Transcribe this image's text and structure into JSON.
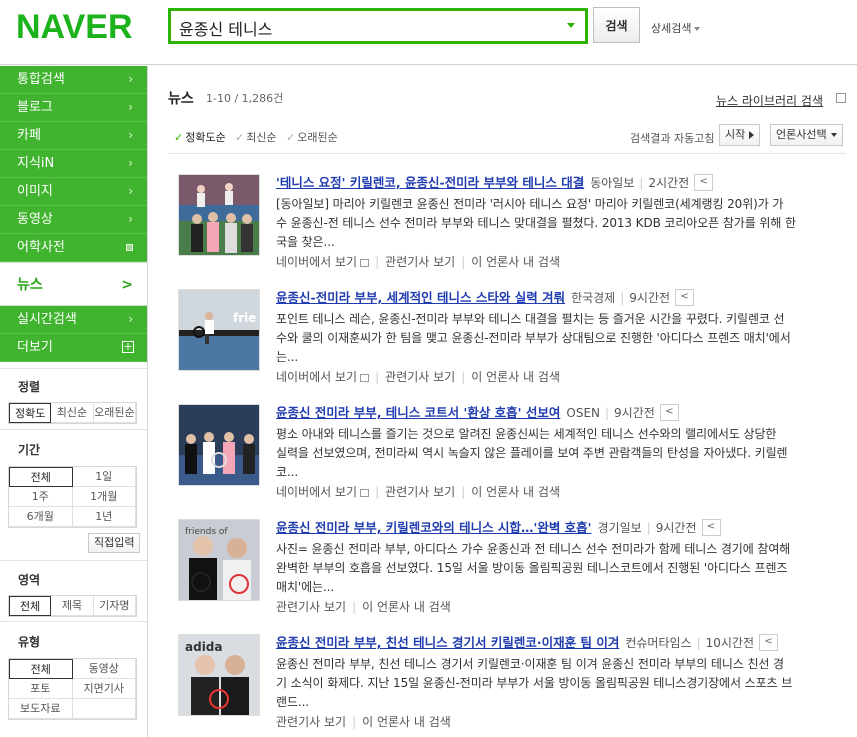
{
  "logo": "NAVER",
  "search": {
    "query": "윤종신 테니스",
    "button": "검색",
    "advanced": "상세검색"
  },
  "sidebar": {
    "items": [
      {
        "label": "통합검색",
        "marker": "›"
      },
      {
        "label": "블로그",
        "marker": "›"
      },
      {
        "label": "카페",
        "marker": "›"
      },
      {
        "label": "지식iN",
        "marker": "›"
      },
      {
        "label": "이미지",
        "marker": "›"
      },
      {
        "label": "동영상",
        "marker": "›"
      },
      {
        "label": "어학사전",
        "marker": "square"
      }
    ],
    "active": {
      "label": "뉴스",
      "marker": ">"
    },
    "items2": [
      {
        "label": "실시간검색",
        "marker": "›"
      },
      {
        "label": "더보기",
        "marker": "+"
      }
    ]
  },
  "filters": {
    "sort": {
      "title": "정렬",
      "options": [
        "정확도",
        "최신순",
        "오래된순"
      ],
      "selected": "정확도"
    },
    "period": {
      "title": "기간",
      "options": [
        "전체",
        "1일",
        "1주",
        "1개월",
        "6개월",
        "1년"
      ],
      "selected": "전체",
      "direct": "직접입력"
    },
    "area": {
      "title": "영역",
      "options": [
        "전체",
        "제목",
        "기자명"
      ],
      "selected": "전체"
    },
    "type": {
      "title": "유형",
      "options": [
        "전체",
        "동영상",
        "포토",
        "지면기사",
        "보도자료",
        ""
      ],
      "selected": "전체"
    }
  },
  "results": {
    "heading": "뉴스",
    "count": "1-10 / 1,286건",
    "library": "뉴스 라이브러리 검색",
    "sort_options": [
      "정확도순",
      "최신순",
      "오래된순"
    ],
    "auto_label": "검색결과 자동고침",
    "start_btn": "시작",
    "press_btn": "언론사선택",
    "items": [
      {
        "title": "'테니스 요정' 키릴렌코, 윤종신-전미라 부부와 테니스 대결",
        "press": "동아일보",
        "time": "2시간전",
        "desc1": "[동아일보] 마리아 키릴렌코 윤종신 전미라 '러시아 테니스 요정' 마리아 키릴렌코(세계랭킹 20위)가 가",
        "desc2": "수 윤종신-전 테니스 선수 전미라 부부와 테니스 맞대결을 펼쳤다. 2013 KDB 코리아오픈 참가를 위해 한",
        "desc3": "국을 찾은...",
        "links": [
          "네이버에서 보기",
          "관련기사 보기",
          "이 언론사 내 검색"
        ],
        "photo": "court"
      },
      {
        "title": "윤종신-전미라 부부, 세계적인 테니스 스타와 실력 겨뤄",
        "press": "한국경제",
        "time": "9시간전",
        "desc1": "포인트 테니스 레슨, 윤종신-전미라 부부와 테니스 대결을 펼치는 등 즐거운 시간을 꾸렸다. 키릴렌코 선",
        "desc2": "수와 쿨의 이재훈씨가 한 팀을 맺고 윤종신-전미라 부부가 상대팀으로 진행한 '아디다스 프렌즈 매치'에서",
        "desc3": "는...",
        "links": [
          "네이버에서 보기",
          "관련기사 보기",
          "이 언론사 내 검색"
        ],
        "photo": "action"
      },
      {
        "title": "윤종신 전미라 부부, 테니스 코트서 '환상 호흡' 선보여",
        "press": "OSEN",
        "time": "9시간전",
        "desc1": "평소 아내와 테니스를 즐기는 것으로 알려진 윤종신씨는 세계적인 테니스 선수와의 랠리에서도 상당한",
        "desc2": "실력을 선보였으며, 전미라씨 역시 녹슬지 않은 플레이를 보여 주변 관람객들의 탄성을 자아냈다. 키릴렌",
        "desc3": "코...",
        "links": [
          "네이버에서 보기",
          "관련기사 보기",
          "이 언론사 내 검색"
        ],
        "photo": "group"
      },
      {
        "title": "윤종신 전미라 부부, 키릴렌코와의 테니스 시합…'완벽 호흡'",
        "press": "경기일보",
        "time": "9시간전",
        "desc1": "사진= 윤종신 전미라 부부, 아디다스 가수 윤종신과 전 테니스 선수 전미라가 함께 테니스 경기에 참여해",
        "desc2": "완벽한 부부의 호흡을 선보였다. 15일 서울 방이동 올림픽공원 테니스코트에서 진행된 '아디다스 프렌즈",
        "desc3": "매치'에는...",
        "links": [
          "관련기사 보기",
          "이 언론사 내 검색"
        ],
        "photo": "pair"
      },
      {
        "title": "윤종신 전미라 부부, 친선 테니스 경기서 키릴렌코·이재훈 팀 이겨",
        "press": "컨슈머타임스",
        "time": "10시간전",
        "desc1": "윤종신 전미라 부부, 친선 테니스 경기서 키릴렌코·이재훈 팀 이겨 윤종신 전미라 부부의 테니스 친선 경",
        "desc2": "기 소식이 화제다. 지난 15일 윤종신-전미라 부부가 서울 방이동 올림픽공원 테니스경기장에서 스포츠 브",
        "desc3": "랜드...",
        "links": [
          "관련기사 보기",
          "이 언론사 내 검색"
        ],
        "photo": "pair2"
      }
    ]
  },
  "colors": {
    "brand": "#1bb21b",
    "nav": "#41b42f",
    "link": "#213caf"
  }
}
